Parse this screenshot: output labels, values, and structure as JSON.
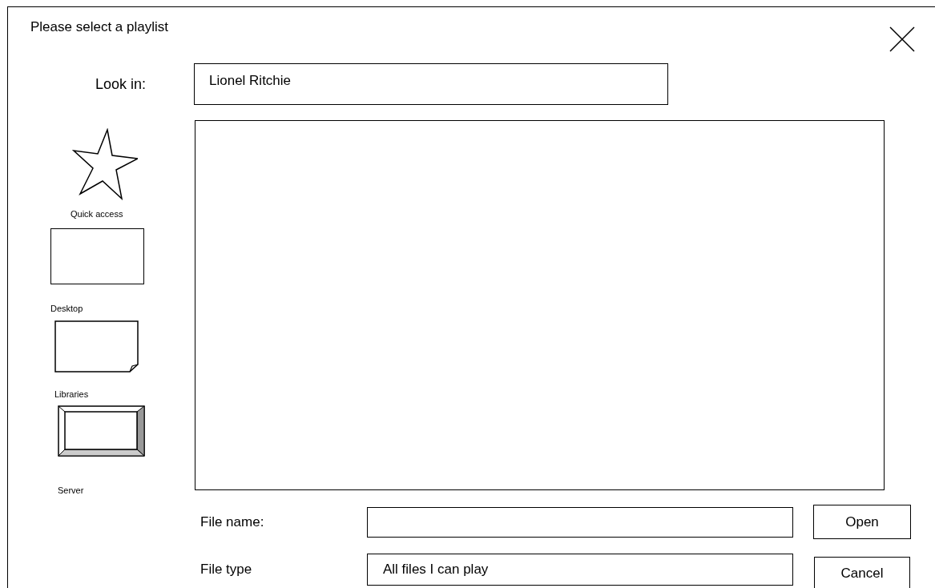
{
  "dialog": {
    "title": "Please select a playlist"
  },
  "look_in": {
    "label": "Look in:",
    "value": "Lionel Ritchie"
  },
  "places": [
    {
      "kind": "star",
      "label": "Quick access"
    },
    {
      "kind": "desktop",
      "label": "Desktop"
    },
    {
      "kind": "library",
      "label": "Libraries"
    },
    {
      "kind": "server",
      "label": "Server"
    }
  ],
  "file_name": {
    "label": "File name:"
  },
  "file_type": {
    "label": "File type",
    "value": "All files I can play"
  },
  "buttons": [
    "Open",
    "Cancel"
  ]
}
